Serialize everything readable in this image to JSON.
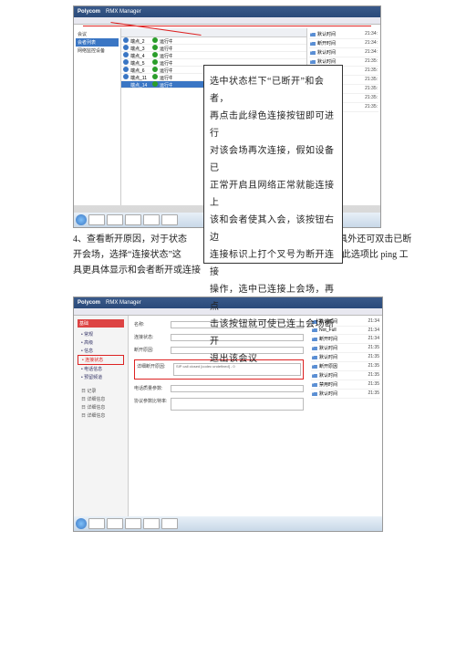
{
  "app": {
    "brand": "Polycom",
    "name": "RMX Manager"
  },
  "shot1": {
    "tree": [
      "会议",
      "会者列表",
      "网络监控设备"
    ],
    "grid": [
      {
        "c1": "端点_2",
        "c2": "运行中",
        "c3": ""
      },
      {
        "c1": "端点_3",
        "c2": "运行中",
        "c3": ""
      },
      {
        "c1": "端点_4",
        "c2": "运行中",
        "c3": ""
      },
      {
        "c1": "端点_5",
        "c2": "运行中",
        "c3": ""
      },
      {
        "c1": "端点_6",
        "c2": "运行中",
        "c3": ""
      },
      {
        "c1": "端点_11",
        "c2": "运行中",
        "c3": ""
      },
      {
        "c1": "端点_14",
        "c2": "运行中",
        "c3": "",
        "sel": true
      }
    ],
    "right_label": "断开时间",
    "right": [
      {
        "n": "默认时间",
        "v": "21:34:"
      },
      {
        "n": "断开时间",
        "v": "21:34:"
      },
      {
        "n": "默认时间",
        "v": "21:34:"
      },
      {
        "n": "默认时间",
        "v": "21:35:"
      },
      {
        "n": "断开原因",
        "v": "21:35:"
      },
      {
        "n": "默认时间",
        "v": "21:35:"
      },
      {
        "n": "默认时间",
        "v": "21:35:"
      },
      {
        "n": "禁用时间",
        "v": "21:35:"
      },
      {
        "n": "默认时间",
        "v": "21:35:"
      }
    ]
  },
  "tooltip": {
    "l1": "选中状态栏下“已断开”和会者，",
    "l2": "再点击此绿色连接按钮即可进行",
    "l3": "对该会场再次连接，假如设备已",
    "l4": "正常开启且网络正常就能连接上",
    "l5": "该和会者使其入会，该按钮右边",
    "l6": "连接标识上打个叉号为断开连接",
    "l7": "操作，选中已连接上会场，再点",
    "l8": "击该按钮就可使已连上会场断开",
    "l9": "退出该会议"
  },
  "para4": {
    "l1a": "4、查看断开原因，对于状态",
    "l1b": "ping 工具外还可双击已断",
    "l2a": "开会场，选择“连接状态”这",
    "l2b": "开原因，此选项比 ping 工",
    "l3": "具更具体显示和会者断开或连接"
  },
  "shot2": {
    "cat_title": "基础",
    "cats": [
      "• 常规",
      "• 高级",
      "• 信息",
      "• 连接状态",
      "• 电话信息",
      "• 预留频道"
    ],
    "cats2": [
      "日 记录",
      "日 详细信息",
      "日 详细信息",
      "日 详细信息"
    ],
    "fields": {
      "name_l": "名称:",
      "name_v": "",
      "status_l": "连接状态:",
      "status_v": "",
      "reason_l": "断开原因:",
      "reason_v": "",
      "detail_l": "详细断开原因:",
      "detail_v": "SIP call closed [codec undefined] - 0",
      "cq_l": "电话质量参数:",
      "cq_v": "",
      "rate_l": "协议参数比特率:",
      "rate_v": ""
    },
    "right": [
      {
        "n": "默认时间",
        "v": "21:34"
      },
      {
        "n": "Not_Full",
        "v": "21:34"
      },
      {
        "n": "断开时间",
        "v": "21:34"
      },
      {
        "n": "默认时间",
        "v": "21:35"
      },
      {
        "n": "默认时间",
        "v": "21:35"
      },
      {
        "n": "断开原因",
        "v": "21:35"
      },
      {
        "n": "默认时间",
        "v": "21:35"
      },
      {
        "n": "禁用时间",
        "v": "21:35"
      },
      {
        "n": "默认时间",
        "v": "21:35"
      }
    ]
  }
}
